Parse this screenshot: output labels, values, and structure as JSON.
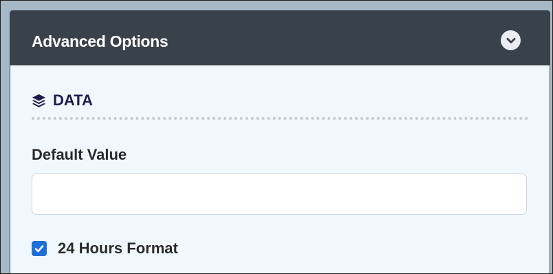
{
  "panel": {
    "title": "Advanced Options",
    "toggle_icon": "chevron-down-circle-icon"
  },
  "section": {
    "icon": "layers-icon",
    "heading": "DATA"
  },
  "default_value": {
    "label": "Default Value",
    "value": "",
    "placeholder": ""
  },
  "hours_format": {
    "label": "24 Hours Format",
    "checked": true
  },
  "colors": {
    "header_bg": "#39424a",
    "panel_bg": "#f1f8fd",
    "checkbox_accent": "#1f6fd6",
    "heading_text": "#1f1b4d"
  }
}
